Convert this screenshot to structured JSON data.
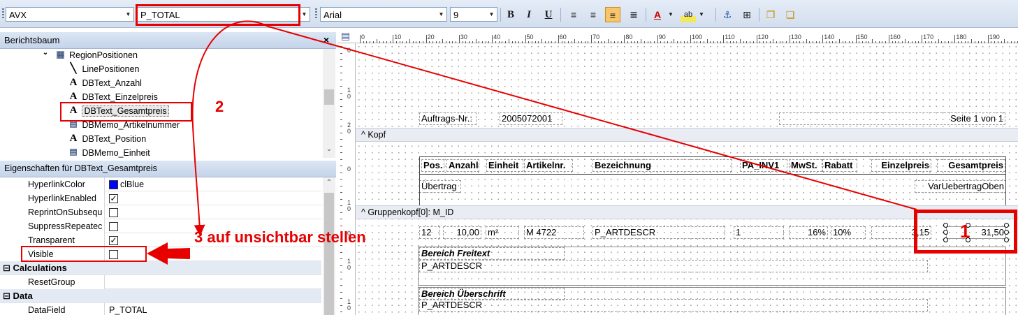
{
  "toolbar": {
    "component_combo": "AVX",
    "datafield_combo": "P_TOTAL",
    "font_combo": "Arial",
    "size_combo": "9",
    "bold_label": "B",
    "italic_label": "I",
    "underline_label": "U"
  },
  "tree_panel": {
    "title": "Berichtsbaum",
    "close_label": "×",
    "items": [
      {
        "label": "RegionPositionen"
      },
      {
        "label": "LinePositionen"
      },
      {
        "label": "DBText_Anzahl"
      },
      {
        "label": "DBText_Einzelpreis"
      },
      {
        "label": "DBText_Gesamtpreis"
      },
      {
        "label": "DBMemo_Artikelnummer"
      },
      {
        "label": "DBText_Position"
      },
      {
        "label": "DBMemo_Einheit"
      }
    ]
  },
  "props_panel": {
    "title": "Eigenschaften für DBText_Gesamtpreis",
    "rows": [
      {
        "name": "HyperlinkColor",
        "value": "clBlue"
      },
      {
        "name": "HyperlinkEnabled",
        "value": "✓"
      },
      {
        "name": "ReprintOnSubsequ",
        "value": ""
      },
      {
        "name": "SuppressRepeatec",
        "value": ""
      },
      {
        "name": "Transparent",
        "value": "✓"
      },
      {
        "name": "Visible",
        "value": ""
      }
    ],
    "cat_calculations": "Calculations",
    "reset_group": "ResetGroup",
    "cat_data": "Data",
    "datafield_name": "DataField",
    "datafield_value": "P_TOTAL"
  },
  "ruler": {
    "h_labels": [
      "0",
      "10",
      "20",
      "30",
      "40",
      "50",
      "60",
      "70",
      "80",
      "90",
      "100",
      "110",
      "120",
      "130",
      "140",
      "150",
      "160",
      "170",
      "180",
      "190"
    ],
    "v_labels": [
      "0",
      "1\n0",
      "2\n0",
      "0",
      "1\n0",
      "0",
      "1\n0",
      "1\n0"
    ]
  },
  "report": {
    "header": {
      "auftrag_label": "Auftrags-Nr.:",
      "auftrag_value": "2005072001",
      "seite": "Seite 1 von 1"
    },
    "band_kopf": "^ Kopf",
    "columns": [
      "Pos.",
      "Anzahl",
      "Einheit",
      "Artikelnr.",
      "Bezeichnung",
      "PA_INV1",
      "MwSt.",
      "Rabatt",
      "Einzelpreis",
      "Gesamtpreis"
    ],
    "uebertrag": "Übertrag",
    "uebertrag_var": "VarUebertragOben",
    "band_gruppe": "^ Gruppenkopf[0]: M_ID",
    "row": [
      "12",
      "10,00",
      "m²",
      "M 4722",
      "P_ARTDESCR",
      "1",
      "16%",
      "10%",
      "3,15",
      "31,50"
    ],
    "bereich_freitext": "Bereich Freitext",
    "freitext_field": "P_ARTDESCR",
    "bereich_ueberschrift": "Bereich Überschrift",
    "ueberschrift_field": "P_ARTDESCR"
  },
  "annotations": {
    "step1": "1",
    "step2": "2",
    "step3": "3 auf unsichtbar stellen",
    "color": "#e60000"
  }
}
